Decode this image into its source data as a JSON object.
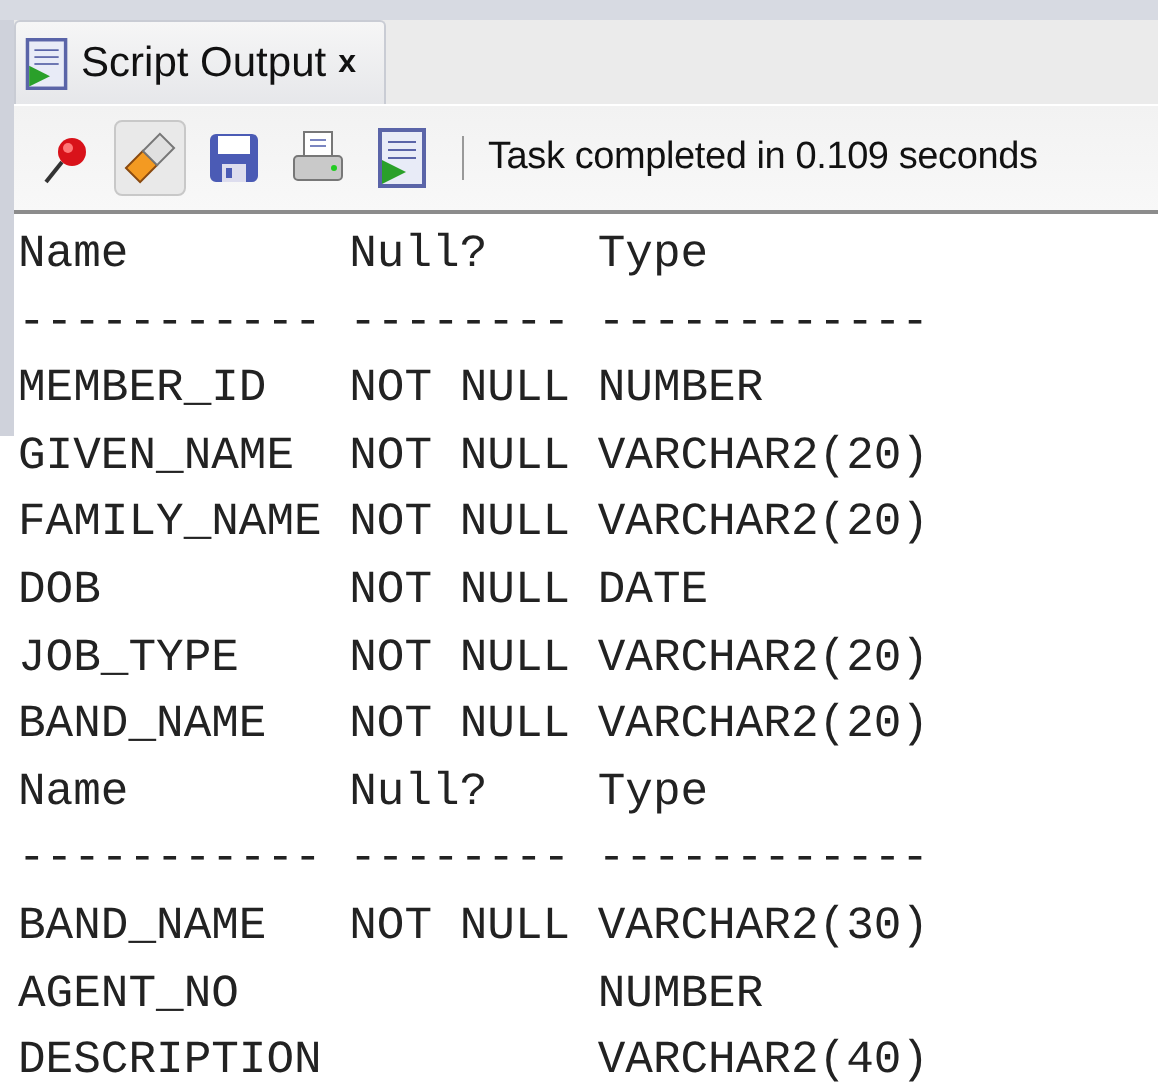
{
  "tab": {
    "label": "Script Output",
    "close": "x",
    "selected": true
  },
  "toolbar": {
    "buttons": [
      {
        "kind": "pin",
        "pressed": false
      },
      {
        "kind": "eraser",
        "pressed": true
      },
      {
        "kind": "save",
        "pressed": false
      },
      {
        "kind": "print",
        "pressed": false
      },
      {
        "kind": "script",
        "pressed": false
      }
    ],
    "status": "Task completed in 0.109 seconds"
  },
  "output": {
    "lines": [
      "Name        Null?    Type",
      "----------- -------- ------------",
      "MEMBER_ID   NOT NULL NUMBER",
      "GIVEN_NAME  NOT NULL VARCHAR2(20)",
      "FAMILY_NAME NOT NULL VARCHAR2(20)",
      "DOB         NOT NULL DATE",
      "JOB_TYPE    NOT NULL VARCHAR2(20)",
      "BAND_NAME   NOT NULL VARCHAR2(20)",
      "Name        Null?    Type",
      "----------- -------- ------------",
      "BAND_NAME   NOT NULL VARCHAR2(30)",
      "AGENT_NO             NUMBER",
      "DESCRIPTION          VARCHAR2(40)"
    ]
  }
}
